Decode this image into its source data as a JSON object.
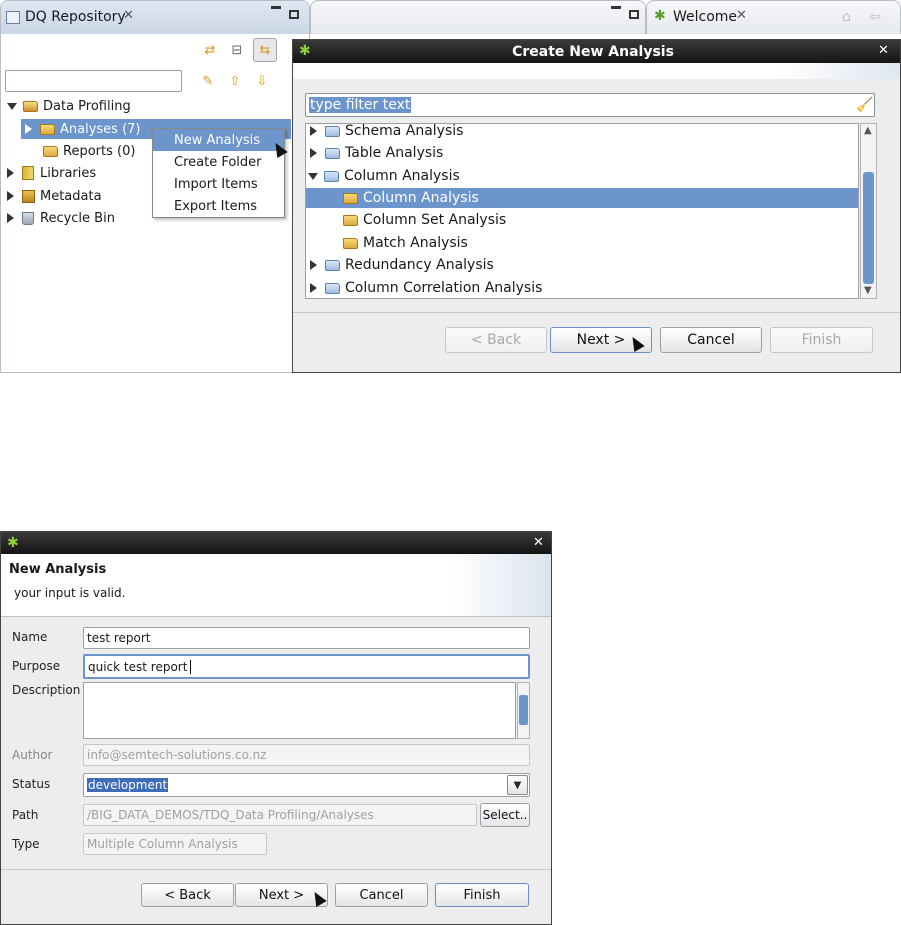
{
  "eclipse": {
    "repo_tab_label": "DQ Repository",
    "welcome_tab_label": "Welcome",
    "tree": [
      {
        "label": "Data Profiling",
        "state": "open"
      },
      {
        "label": "Analyses (7)",
        "state": "closed",
        "selected": true
      },
      {
        "label": "Reports (0)",
        "state": "leaf"
      },
      {
        "label": "Libraries",
        "state": "closed"
      },
      {
        "label": "Metadata",
        "state": "closed"
      },
      {
        "label": "Recycle Bin",
        "state": "closed"
      }
    ],
    "context_menu": [
      "New Analysis",
      "Create Folder",
      "Import Items",
      "Export Items"
    ]
  },
  "wizard": {
    "title": "Create New Analysis",
    "filter_placeholder": "type filter text",
    "items": [
      {
        "label": "Schema Analysis",
        "state": "closed",
        "level": 0
      },
      {
        "label": "Table Analysis",
        "state": "closed",
        "level": 0
      },
      {
        "label": "Column Analysis",
        "state": "open",
        "level": 0
      },
      {
        "label": "Column Analysis",
        "state": "leaf",
        "level": 1,
        "selected": true
      },
      {
        "label": "Column Set Analysis",
        "state": "leaf",
        "level": 1
      },
      {
        "label": "Match Analysis",
        "state": "leaf",
        "level": 1
      },
      {
        "label": "Redundancy Analysis",
        "state": "closed",
        "level": 0
      },
      {
        "label": "Column Correlation Analysis",
        "state": "closed",
        "level": 0
      }
    ],
    "buttons": {
      "back": "< Back",
      "next": "Next >",
      "cancel": "Cancel",
      "finish": "Finish"
    }
  },
  "new_analysis": {
    "header_title": "New Analysis",
    "header_message": "your input is valid.",
    "labels": {
      "name": "Name",
      "purpose": "Purpose",
      "description": "Description",
      "author": "Author",
      "status": "Status",
      "path": "Path",
      "type": "Type"
    },
    "values": {
      "name": "test report",
      "purpose": "quick test report",
      "description": "",
      "author": "info@semtech-solutions.co.nz",
      "status": "development",
      "path": "/BIG_DATA_DEMOS/TDQ_Data Profiling/Analyses",
      "type": "Multiple Column Analysis"
    },
    "select_button": "Select..",
    "buttons": {
      "back": "< Back",
      "next": "Next >",
      "cancel": "Cancel",
      "finish": "Finish"
    }
  },
  "colors": {
    "selection": "#6c95cc",
    "title_bar": "#1f1f1f",
    "text_selection": "#3d6cb8"
  }
}
